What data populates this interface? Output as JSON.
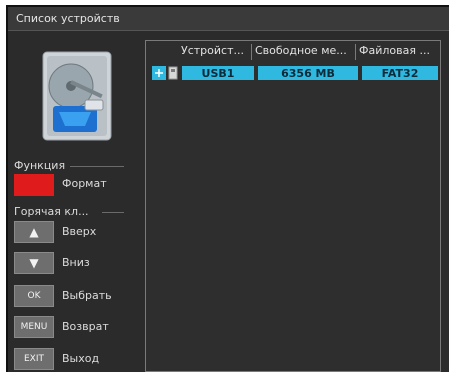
{
  "window": {
    "title": "Список устройств"
  },
  "device": {
    "icon": "hard-drive-usb-icon"
  },
  "function_section": {
    "label": "Функция",
    "color_key": "#e01b1b",
    "action_label": "Формат"
  },
  "hotkey_section": {
    "label": "Горячая кл...",
    "items": [
      {
        "key": "▲",
        "label": "Вверх"
      },
      {
        "key": "▼",
        "label": "Вниз"
      },
      {
        "key": "OK",
        "label": "Выбрать"
      },
      {
        "key": "MENU",
        "label": "Возврат"
      },
      {
        "key": "EXIT",
        "label": "Выход"
      }
    ]
  },
  "table": {
    "columns": [
      "Устройст...",
      "Свободное ме...",
      "Файловая ..."
    ],
    "rows": [
      {
        "device": "USB1",
        "free_space": "6356 MB",
        "file_system": "FAT32",
        "icon": "usb-device-icon"
      }
    ]
  },
  "colors": {
    "selected_row": "#2fb8e0",
    "background": "#2b2b2b",
    "accent_red": "#e01b1b"
  }
}
